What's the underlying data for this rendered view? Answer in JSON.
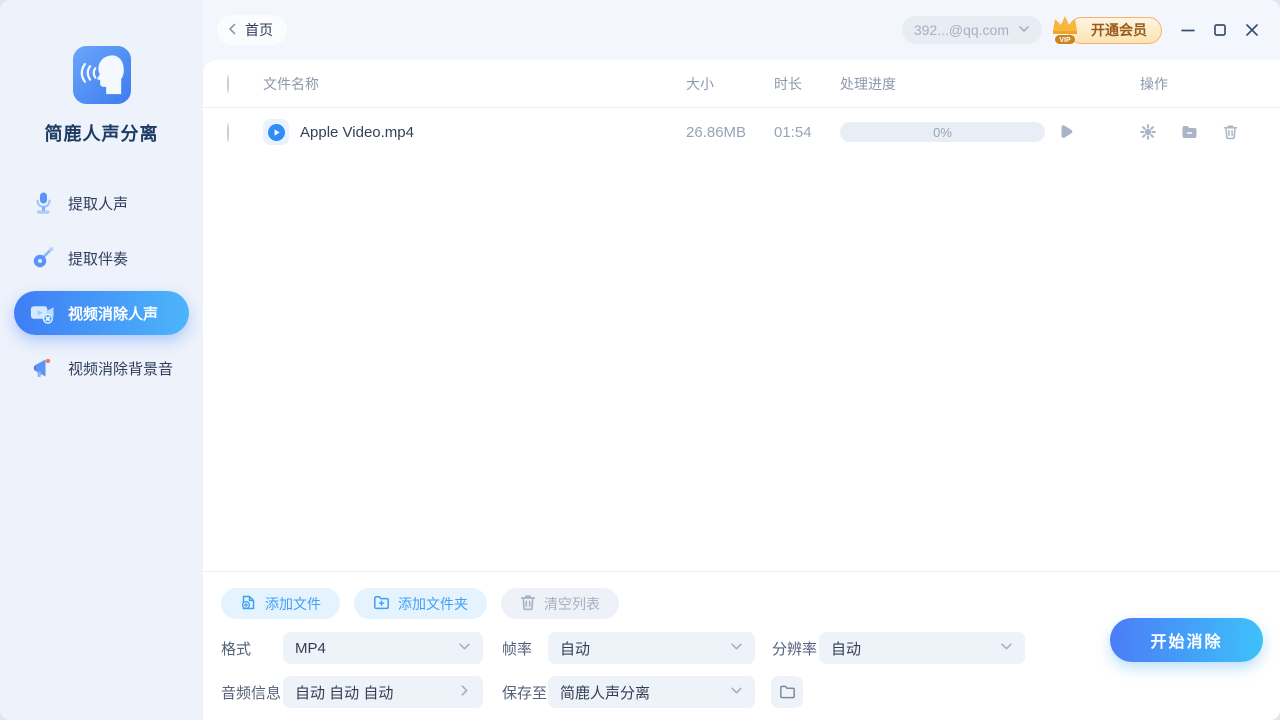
{
  "app_name": "简鹿人声分离",
  "sidebar": {
    "items": [
      {
        "label": "提取人声",
        "icon": "microphone-icon",
        "active": false
      },
      {
        "label": "提取伴奏",
        "icon": "guitar-icon",
        "active": false
      },
      {
        "label": "视频消除人声",
        "icon": "video-camera-icon",
        "active": true
      },
      {
        "label": "视频消除背景音",
        "icon": "megaphone-icon",
        "active": false
      }
    ]
  },
  "topbar": {
    "back_label": "首页",
    "account": "392...@qq.com",
    "vip_badge": "VIP",
    "vip_label": "开通会员"
  },
  "table": {
    "headers": {
      "name": "文件名称",
      "size": "大小",
      "duration": "时长",
      "progress": "处理进度",
      "ops": "操作"
    },
    "rows": [
      {
        "name": "Apple Video.mp4",
        "size": "26.86MB",
        "duration": "01:54",
        "progress": "0%"
      }
    ]
  },
  "actions": {
    "add_file": "添加文件",
    "add_folder": "添加文件夹",
    "clear_list": "清空列表"
  },
  "settings": {
    "format": {
      "label": "格式",
      "value": "MP4"
    },
    "framerate": {
      "label": "帧率",
      "value": "自动"
    },
    "resolution": {
      "label": "分辨率",
      "value": "自动"
    },
    "audio_info": {
      "label": "音频信息",
      "value": "自动 自动 自动"
    },
    "save_to": {
      "label": "保存至",
      "value": "简鹿人声分离"
    }
  },
  "start_button": "开始消除",
  "icons": {
    "back-chevron-icon": "‹",
    "chevron-down-icon": "∨",
    "chevron-right-icon": "›",
    "crown-icon": "golden crown",
    "minimize-icon": "—",
    "maximize-icon": "□",
    "close-icon": "✕",
    "play-circle-icon": "▶ in circle",
    "play-icon": "▶",
    "gear-icon": "⚙",
    "folder-icon": "folder",
    "trash-icon": "trash can",
    "file-plus-icon": "document +",
    "folder-plus-icon": "folder +"
  },
  "colors": {
    "accent_blue": "#3f7df6",
    "accent_gradient_end": "#4cb5f9",
    "start_gradient": [
      "#4a7df7",
      "#3ec1f9"
    ],
    "vip_border": "#f3b469",
    "vip_text": "#9a5a1d",
    "sidebar_bg": "#edf2fb",
    "topbar_bg": "#f3f7fd",
    "card_bg": "#ffffff",
    "muted_text": "#97a3b7",
    "progress_bg": "#e9eef6"
  }
}
